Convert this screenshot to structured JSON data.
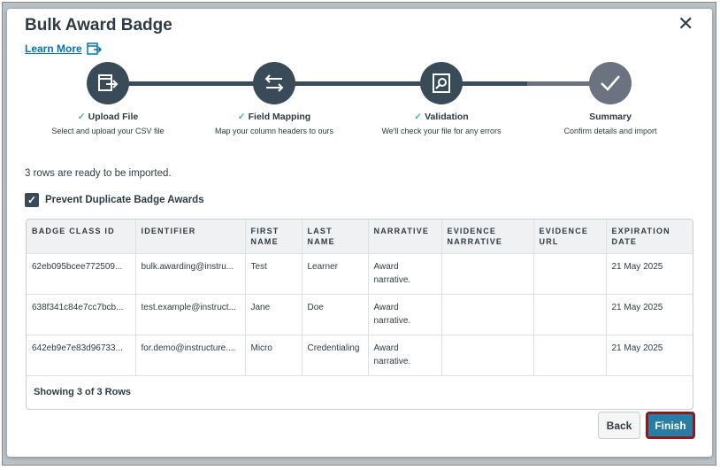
{
  "modal": {
    "title": "Bulk Award Badge",
    "learn_more": "Learn More",
    "close_icon": "close-icon"
  },
  "steps": [
    {
      "label": "Upload File",
      "desc": "Select and upload your CSV file",
      "done": true,
      "icon": "upload-file-icon"
    },
    {
      "label": "Field Mapping",
      "desc": "Map your column headers to ours",
      "done": true,
      "icon": "arrows-swap-icon"
    },
    {
      "label": "Validation",
      "desc": "We'll check your file for any errors",
      "done": true,
      "icon": "search-file-icon"
    },
    {
      "label": "Summary",
      "desc": "Confirm details and import",
      "done": false,
      "icon": "check-icon"
    }
  ],
  "check": "✓",
  "ready_text": "3 rows are ready to be imported.",
  "prevent_duplicates": {
    "label": "Prevent Duplicate Badge Awards",
    "checked": true
  },
  "table": {
    "headers": [
      "BADGE CLASS ID",
      "IDENTIFIER",
      "FIRST NAME",
      "LAST NAME",
      "NARRATIVE",
      "EVIDENCE NARRATIVE",
      "EVIDENCE URL",
      "EXPIRATION DATE"
    ],
    "rows": [
      [
        "62eb095bcee772509...",
        "bulk.awarding@instru...",
        "Test",
        "Learner",
        "Award narrative.",
        "",
        "",
        "21 May 2025"
      ],
      [
        "638f341c84e7cc7bcb...",
        "test.example@instruct...",
        "Jane",
        "Doe",
        "Award narrative.",
        "",
        "",
        "21 May 2025"
      ],
      [
        "642eb9e7e83d96733...",
        "for.demo@instructure....",
        "Micro",
        "Credentialing",
        "Award narrative.",
        "",
        "",
        "21 May 2025"
      ]
    ],
    "footer": "Showing 3 of 3 Rows"
  },
  "buttons": {
    "back": "Back",
    "finish": "Finish"
  }
}
